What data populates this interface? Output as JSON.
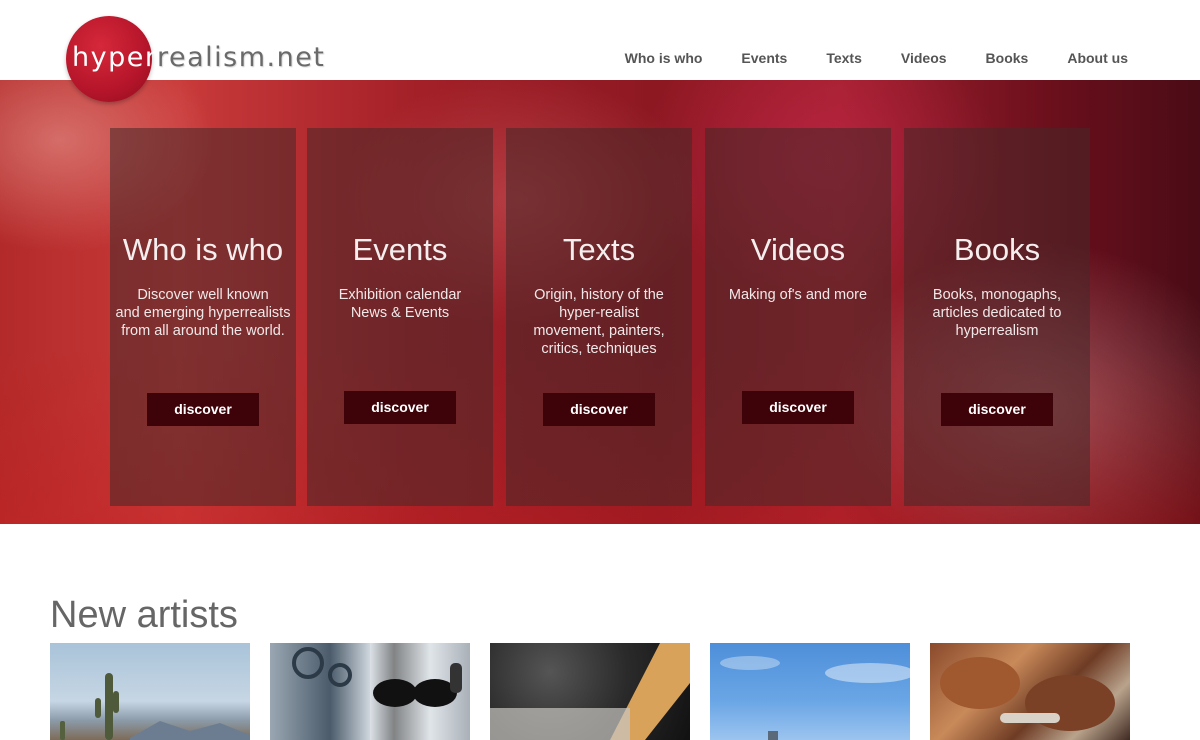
{
  "logo": {
    "part1": "hyper",
    "part2": "realism.net"
  },
  "nav": [
    {
      "label": "Who is who"
    },
    {
      "label": "Events"
    },
    {
      "label": "Texts"
    },
    {
      "label": "Videos"
    },
    {
      "label": "Books"
    },
    {
      "label": "About us"
    }
  ],
  "cards": [
    {
      "title": "Who is who",
      "desc": "Discover well known\nand emerging hyperrealists\nfrom all around the world.",
      "button": "discover"
    },
    {
      "title": "Events",
      "desc": "Exhibition calendar\nNews & Events",
      "button": "discover"
    },
    {
      "title": "Texts",
      "desc": "Origin, history of the\nhyper-realist\nmovement, painters,\ncritics, techniques",
      "button": "discover"
    },
    {
      "title": "Videos",
      "desc": "Making of's and more",
      "button": "discover"
    },
    {
      "title": "Books",
      "desc": "Books, monogaphs,\narticles dedicated to\nhyperrealism",
      "button": "discover"
    }
  ],
  "new_artists": {
    "title": "New artists"
  },
  "colors": {
    "accent": "#c0182c",
    "button_bg": "#3e0308",
    "nav_text": "#555555"
  }
}
